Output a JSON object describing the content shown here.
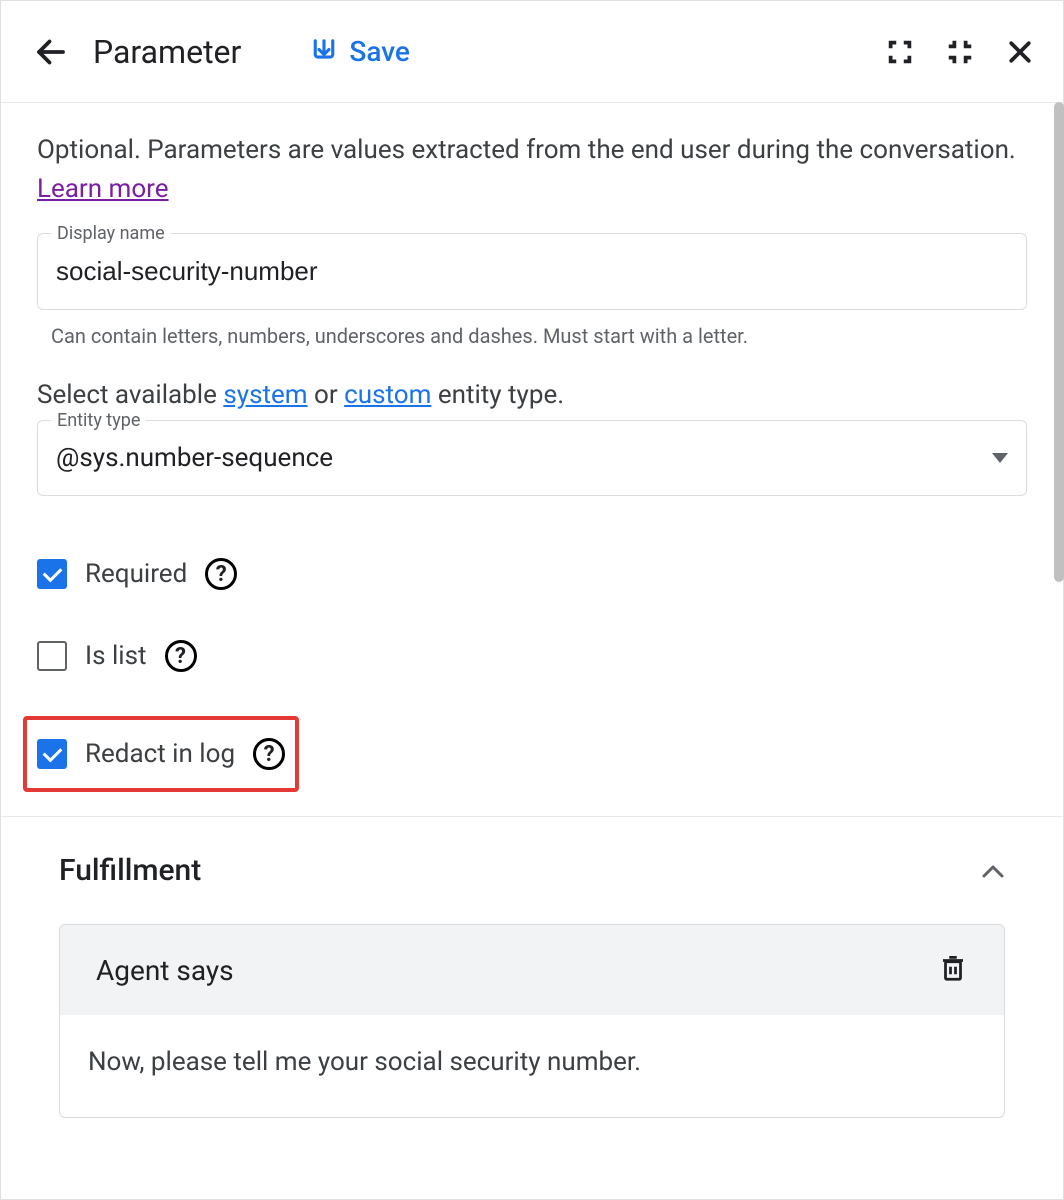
{
  "header": {
    "title": "Parameter",
    "save_label": "Save"
  },
  "description": {
    "text_prefix": "Optional. Parameters are values extracted from the end user during the conversation. ",
    "learn_more": "Learn more"
  },
  "display_name": {
    "label": "Display name",
    "value": "social-security-number",
    "helper": "Can contain letters, numbers, underscores and dashes. Must start with a letter."
  },
  "entity": {
    "prompt_prefix": "Select available ",
    "system_link": "system",
    "prompt_mid": " or ",
    "custom_link": "custom",
    "prompt_suffix": " entity type.",
    "label": "Entity type",
    "value": "@sys.number-sequence"
  },
  "checkboxes": {
    "required": {
      "label": "Required",
      "checked": true
    },
    "is_list": {
      "label": "Is list",
      "checked": false
    },
    "redact": {
      "label": "Redact in log",
      "checked": true
    }
  },
  "fulfillment": {
    "title": "Fulfillment",
    "agent_says_label": "Agent says",
    "agent_text": "Now, please tell me your social security number."
  }
}
